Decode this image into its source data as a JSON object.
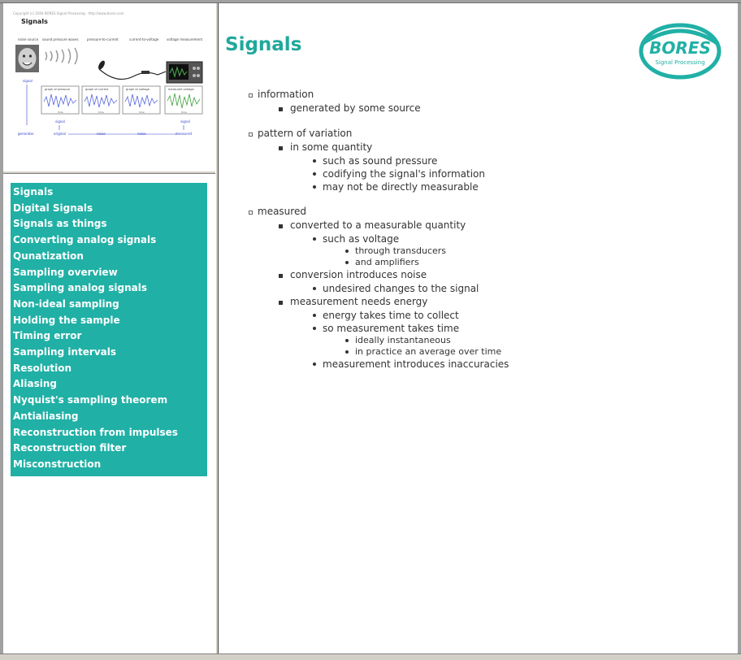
{
  "slide_thumbnail": {
    "copyright": "Copyright (c) 2004 BORES Signal Processing - http://www.bores.com",
    "title": "Signals",
    "stages": [
      "noise source",
      "sound pressure waves",
      "pressure-to-current",
      "current-to-voltage",
      "voltage measurement"
    ],
    "graphs": [
      "graph of pressure",
      "graph of current",
      "graph of voltage",
      "measured voltage"
    ],
    "signal_labels": [
      "signal",
      "signal",
      "signal"
    ],
    "flow_labels": [
      "generator",
      "original",
      "noise",
      "noise",
      "measured"
    ],
    "axis_label": "time"
  },
  "nav": {
    "items": [
      "Signals",
      "Digital Signals",
      "Signals as things",
      "Converting analog signals",
      "Qunatization",
      "Sampling overview",
      "Sampling analog signals",
      "Non-ideal sampling",
      "Holding the sample",
      "Timing error",
      "Sampling intervals",
      "Resolution",
      "Aliasing",
      "Nyquist's sampling theorem",
      "Antialiasing",
      "Reconstruction from impulses",
      "Reconstruction filter",
      "Misconstruction"
    ]
  },
  "page": {
    "title": "Signals",
    "logo_text": "BORES",
    "logo_subtext": "Signal Processing",
    "accent_color": "#20b0a5"
  },
  "content": {
    "sections": [
      {
        "text": "information",
        "children": [
          {
            "text": "generated by some source",
            "children": []
          }
        ]
      },
      {
        "text": "pattern of variation",
        "children": [
          {
            "text": "in some quantity",
            "children": [
              {
                "text": "such as sound pressure",
                "children": []
              },
              {
                "text": "codifying the signal's information",
                "children": []
              },
              {
                "text": "may not be directly measurable",
                "children": []
              }
            ]
          }
        ]
      },
      {
        "text": "measured",
        "children": [
          {
            "text": "converted to a measurable quantity",
            "children": [
              {
                "text": "such as voltage",
                "children": [
                  {
                    "text": "through transducers"
                  },
                  {
                    "text": "and amplifiers"
                  }
                ]
              }
            ]
          },
          {
            "text": "conversion introduces noise",
            "children": [
              {
                "text": "undesired changes to the signal",
                "children": []
              }
            ]
          },
          {
            "text": "measurement needs energy",
            "children": [
              {
                "text": "energy takes time to collect",
                "children": []
              },
              {
                "text": "so measurement takes time",
                "children": [
                  {
                    "text": "ideally instantaneous"
                  },
                  {
                    "text": "in practice an average over time"
                  }
                ]
              },
              {
                "text": "measurement introduces inaccuracies",
                "children": []
              }
            ]
          }
        ]
      }
    ]
  }
}
